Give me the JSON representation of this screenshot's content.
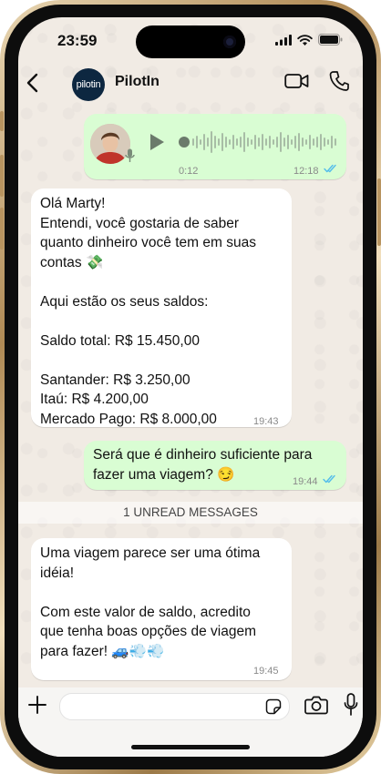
{
  "status_bar": {
    "time": "23:59"
  },
  "chat_header": {
    "avatar_text": "pilotin",
    "contact_name": "PilotIn"
  },
  "messages": [
    {
      "type": "voice",
      "direction": "outgoing",
      "duration": "0:12",
      "time": "12:18",
      "read": true
    },
    {
      "type": "text",
      "direction": "incoming",
      "lines": [
        "Olá Marty!",
        "Entendi, você gostaria de saber",
        "quanto dinheiro você tem em suas",
        "contas 💸",
        "",
        "Aqui estão os seus saldos:",
        "",
        "Saldo total: R$ 15.450,00",
        "",
        "Santander: R$ 3.250,00",
        "Itaú: R$ 4.200,00",
        "Mercado Pago: R$ 8.000,00"
      ],
      "time": "19:43"
    },
    {
      "type": "text",
      "direction": "outgoing",
      "lines": [
        "Será que é dinheiro suficiente para",
        "fazer uma viagem? 😏"
      ],
      "time": "19:44",
      "read": true
    },
    {
      "type": "text",
      "direction": "incoming",
      "lines": [
        "Uma viagem parece ser uma ótima",
        "idéia!",
        "",
        "Com este valor de saldo, acredito",
        "que tenha boas opções de viagem",
        "para fazer! 🚙💨💨"
      ],
      "time": "19:45"
    }
  ],
  "unread_banner": "1 UNREAD MESSAGES",
  "input": {
    "placeholder": ""
  },
  "colors": {
    "outgoing_bubble": "#d9fdd3",
    "incoming_bubble": "#ffffff",
    "chat_background": "#f1ebe4",
    "read_ticks": "#53bdeb"
  }
}
